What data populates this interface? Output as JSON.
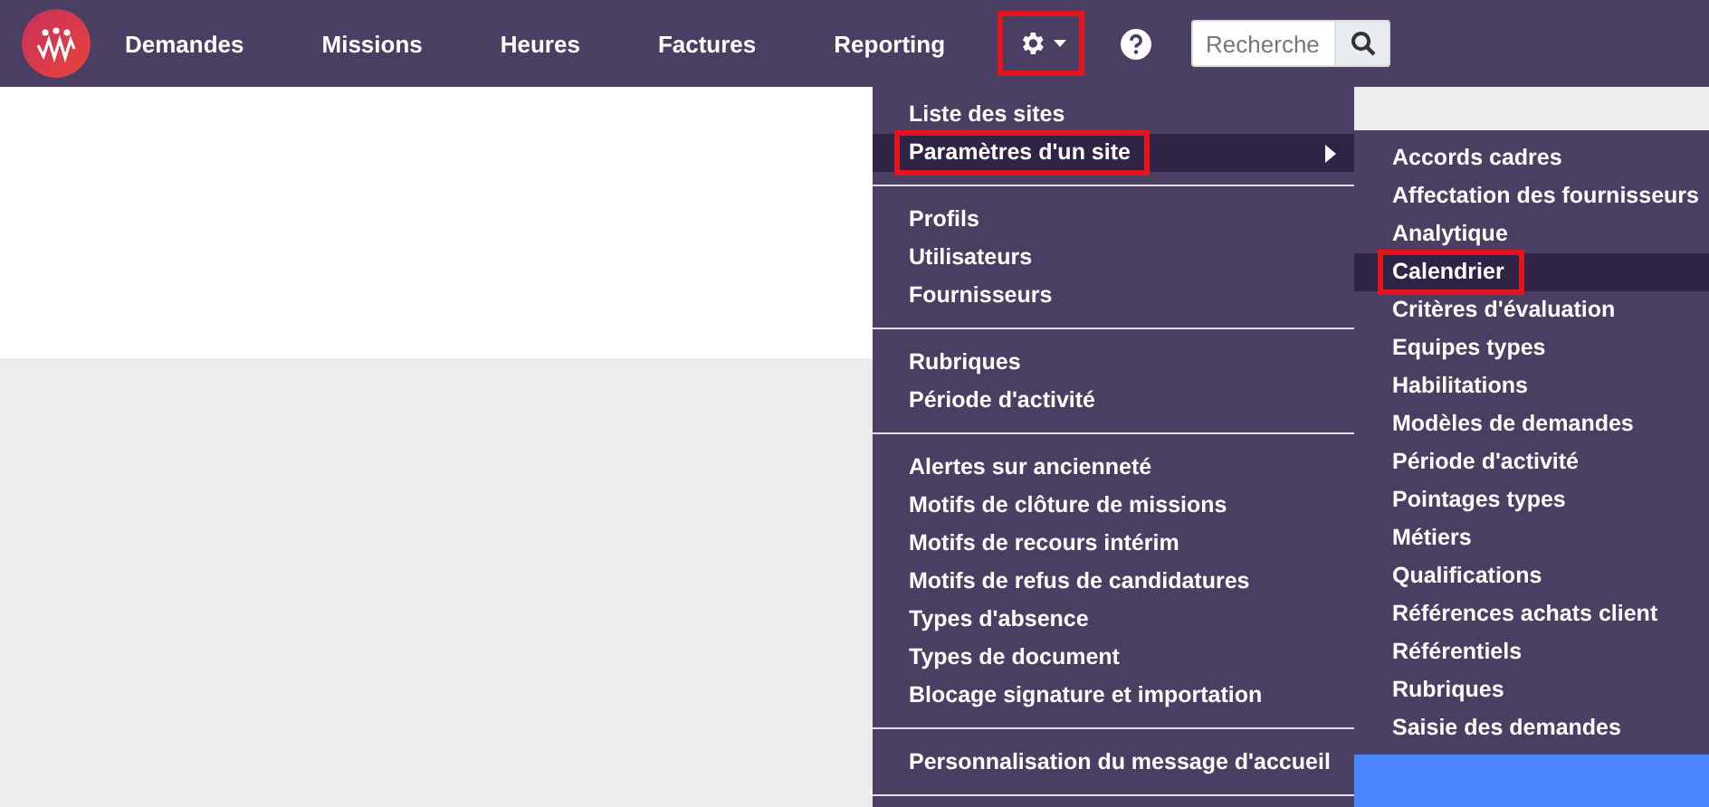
{
  "nav": {
    "items": [
      {
        "label": "Demandes"
      },
      {
        "label": "Missions"
      },
      {
        "label": "Heures"
      },
      {
        "label": "Factures"
      },
      {
        "label": "Reporting"
      }
    ]
  },
  "settings_button": {
    "expanded": true,
    "highlighted": true
  },
  "search": {
    "placeholder": "Recherche"
  },
  "menu": {
    "groups": [
      {
        "items": [
          {
            "label": "Liste des sites",
            "selected": false,
            "highlighted": false,
            "has_submenu": false
          },
          {
            "label": "Paramètres d'un site",
            "selected": true,
            "highlighted": true,
            "has_submenu": true
          }
        ]
      },
      {
        "items": [
          {
            "label": "Profils",
            "selected": false,
            "highlighted": false,
            "has_submenu": false
          },
          {
            "label": "Utilisateurs",
            "selected": false,
            "highlighted": false,
            "has_submenu": false
          },
          {
            "label": "Fournisseurs",
            "selected": false,
            "highlighted": false,
            "has_submenu": false
          }
        ]
      },
      {
        "items": [
          {
            "label": "Rubriques",
            "selected": false,
            "highlighted": false,
            "has_submenu": false
          },
          {
            "label": "Période d'activité",
            "selected": false,
            "highlighted": false,
            "has_submenu": false
          }
        ]
      },
      {
        "items": [
          {
            "label": "Alertes sur ancienneté",
            "selected": false,
            "highlighted": false,
            "has_submenu": false
          },
          {
            "label": "Motifs de clôture de missions",
            "selected": false,
            "highlighted": false,
            "has_submenu": false
          },
          {
            "label": "Motifs de recours intérim",
            "selected": false,
            "highlighted": false,
            "has_submenu": false
          },
          {
            "label": "Motifs de refus de candidatures",
            "selected": false,
            "highlighted": false,
            "has_submenu": false
          },
          {
            "label": "Types d'absence",
            "selected": false,
            "highlighted": false,
            "has_submenu": false
          },
          {
            "label": "Types de document",
            "selected": false,
            "highlighted": false,
            "has_submenu": false
          },
          {
            "label": "Blocage signature et importation",
            "selected": false,
            "highlighted": false,
            "has_submenu": false
          }
        ]
      },
      {
        "items": [
          {
            "label": "Personnalisation du message d'accueil",
            "selected": false,
            "highlighted": false,
            "has_submenu": false
          }
        ]
      }
    ]
  },
  "submenu": {
    "items": [
      {
        "label": "Accords cadres",
        "selected": false,
        "highlighted": false
      },
      {
        "label": "Affectation des fournisseurs",
        "selected": false,
        "highlighted": false
      },
      {
        "label": "Analytique",
        "selected": false,
        "highlighted": false
      },
      {
        "label": "Calendrier",
        "selected": true,
        "highlighted": true
      },
      {
        "label": "Critères d'évaluation",
        "selected": false,
        "highlighted": false
      },
      {
        "label": "Equipes types",
        "selected": false,
        "highlighted": false
      },
      {
        "label": "Habilitations",
        "selected": false,
        "highlighted": false
      },
      {
        "label": "Modèles de demandes",
        "selected": false,
        "highlighted": false
      },
      {
        "label": "Période d'activité",
        "selected": false,
        "highlighted": false
      },
      {
        "label": "Pointages types",
        "selected": false,
        "highlighted": false
      },
      {
        "label": "Métiers",
        "selected": false,
        "highlighted": false
      },
      {
        "label": "Qualifications",
        "selected": false,
        "highlighted": false
      },
      {
        "label": "Références achats client",
        "selected": false,
        "highlighted": false
      },
      {
        "label": "Référentiels",
        "selected": false,
        "highlighted": false
      },
      {
        "label": "Rubriques",
        "selected": false,
        "highlighted": false
      },
      {
        "label": "Saisie des demandes",
        "selected": false,
        "highlighted": false
      }
    ]
  }
}
